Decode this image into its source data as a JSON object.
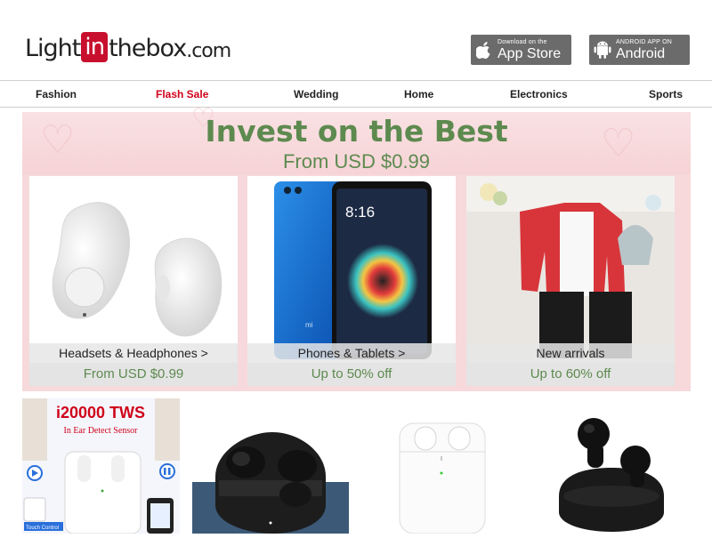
{
  "logo": {
    "part1": "Light",
    "part2": "in",
    "part3": "thebox",
    "part4": ".com"
  },
  "apps": {
    "appstore": {
      "small": "Download on the",
      "big": "App Store"
    },
    "android": {
      "small": "ANDROID APP ON",
      "big": "Android"
    }
  },
  "nav": {
    "items": [
      "Fashion",
      "Flash Sale",
      "Wedding",
      "Home",
      "Electronics",
      "Sports"
    ]
  },
  "banner": {
    "title": "Invest on the Best",
    "subtitle": "From USD $0.99",
    "cards": [
      {
        "label": "Headsets & Headphones >",
        "price": "From USD $0.99"
      },
      {
        "label": "Phones & Tablets >",
        "price": "Up to 50% off"
      },
      {
        "label": "New arrivals",
        "price": "Up to 60% off"
      }
    ],
    "phone_time": "8:16",
    "phone_brand": "mi"
  },
  "products": {
    "p1_title": "i20000 TWS",
    "p1_subtitle": "In Ear Detect Sensor",
    "p1_touch": "Touch Control"
  },
  "colors": {
    "brand_red": "#c8102e",
    "nav_red": "#d0021b",
    "green": "#5d8a4f",
    "banner_pink": "#f7d9db"
  }
}
